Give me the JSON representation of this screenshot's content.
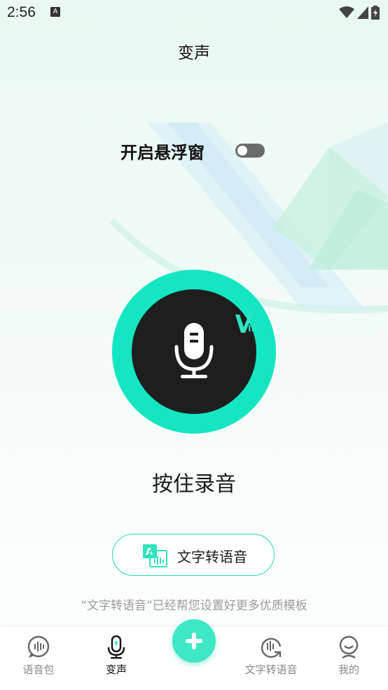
{
  "status_bar": {
    "time": "2:56",
    "notification_glyph": "A"
  },
  "page": {
    "title": "变声"
  },
  "floating_window": {
    "label": "开启悬浮窗",
    "enabled": false
  },
  "record": {
    "label": "按住录音",
    "badge": "VIP"
  },
  "tts_button": {
    "label": "文字转语音"
  },
  "hint": "“文字转语音”已经帮您设置好更多优质模板",
  "tabbar": {
    "items": [
      {
        "label": "语音包",
        "icon": "voice-pack-icon",
        "active": false
      },
      {
        "label": "变声",
        "icon": "microphone-icon",
        "active": true
      },
      {
        "label": "",
        "icon": "plus-icon",
        "active": false
      },
      {
        "label": "文字转语音",
        "icon": "text-to-speech-icon",
        "active": false
      },
      {
        "label": "我的",
        "icon": "profile-icon",
        "active": false
      }
    ]
  },
  "colors": {
    "accent": "#14e6c2",
    "fab": "#3ee8c7",
    "record_inner": "#1e1e1e"
  }
}
